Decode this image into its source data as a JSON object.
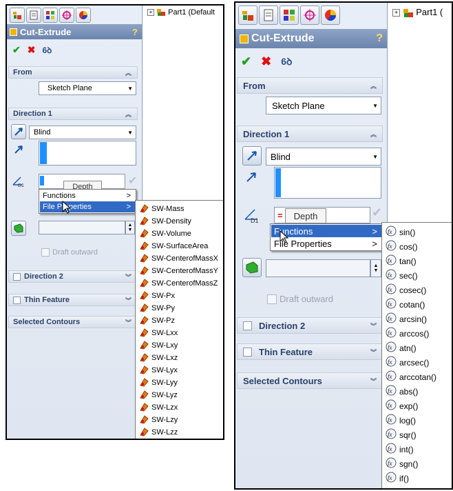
{
  "left": {
    "tree_label": "Part1  (Default",
    "title": "Cut-Extrude",
    "help": "?",
    "from": {
      "header": "From",
      "value": "Sketch Plane"
    },
    "direction1": {
      "header": "Direction 1",
      "end_condition": "Blind",
      "depth_placeholder": "Depth",
      "draft_outward": "Draft outward"
    },
    "direction2": "Direction 2",
    "thin_feature": "Thin Feature",
    "selected_contours": "Selected Contours",
    "menu": [
      {
        "label": "Functions",
        "arrow": ">"
      },
      {
        "label": "File Properties",
        "arrow": ">"
      }
    ],
    "file_properties": [
      "SW-Mass",
      "SW-Density",
      "SW-Volume",
      "SW-SurfaceArea",
      "SW-CenterofMassX",
      "SW-CenterofMassY",
      "SW-CenterofMassZ",
      "SW-Px",
      "SW-Py",
      "SW-Pz",
      "SW-Lxx",
      "SW-Lxy",
      "SW-Lxz",
      "SW-Lyx",
      "SW-Lyy",
      "SW-Lyz",
      "SW-Lzx",
      "SW-Lzy",
      "SW-Lzz"
    ]
  },
  "right": {
    "tree_label": "Part1  (",
    "title": "Cut-Extrude",
    "help": "?",
    "from": {
      "header": "From",
      "value": "Sketch Plane"
    },
    "direction1": {
      "header": "Direction 1",
      "end_condition": "Blind",
      "depth_value": "=",
      "depth_placeholder": "Depth",
      "draft_outward": "Draft outward"
    },
    "direction2": "Direction 2",
    "thin_feature": "Thin Feature",
    "selected_contours": "Selected Contours",
    "menu": [
      {
        "label": "Functions",
        "arrow": ">"
      },
      {
        "label": "File Properties",
        "arrow": ">"
      }
    ],
    "functions": [
      "sin()",
      "cos()",
      "tan()",
      "sec()",
      "cosec()",
      "cotan()",
      "arcsin()",
      "arccos()",
      "atn()",
      "arcsec()",
      "arccotan()",
      "abs()",
      "exp()",
      "log()",
      "sqr()",
      "int()",
      "sgn()",
      "if()"
    ]
  },
  "icons": {
    "toolbar": [
      "feature-manager-icon",
      "property-manager-icon",
      "configuration-manager-icon",
      "dimxpert-icon",
      "display-manager-icon"
    ],
    "ok": "checkmark-icon",
    "cancel": "x-icon",
    "preview": "glasses-icon"
  },
  "colors": {
    "title_bar": "#7a91b8",
    "highlight": "#316ac5",
    "section_text": "#29416b",
    "depth_bar": "#1e90ff"
  }
}
